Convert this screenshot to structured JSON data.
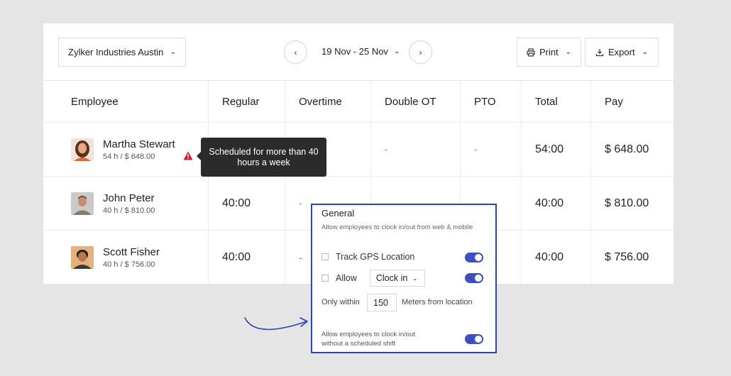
{
  "toolbar": {
    "org": "Zylker Industries Austin",
    "date_range": "19 Nov - 25 Nov",
    "print_label": "Print",
    "export_label": "Export"
  },
  "table": {
    "headers": [
      "Employee",
      "Regular",
      "Overtime",
      "Double OT",
      "PTO",
      "Total",
      "Pay"
    ],
    "rows": [
      {
        "name": "Martha Stewart",
        "sub": "54 h / $ 648.00",
        "regular": "",
        "overtime": "",
        "double_ot": "-",
        "pto": "-",
        "total": "54:00",
        "pay": "$ 648.00"
      },
      {
        "name": "John Peter",
        "sub": "40 h / $ 810.00",
        "regular": "40:00",
        "overtime": "-",
        "double_ot": "",
        "pto": "",
        "total": "40:00",
        "pay": "$ 810.00"
      },
      {
        "name": "Scott Fisher",
        "sub": "40 h / $ 756.00",
        "regular": "40:00",
        "overtime": "-",
        "double_ot": "",
        "pto": "",
        "total": "40:00",
        "pay": "$ 756.00"
      }
    ]
  },
  "tooltip": {
    "text": "Scheduled for more than 40 hours a week"
  },
  "panel": {
    "title": "General",
    "description": "Allow employees to clock in/out from web & mobile",
    "gps_label": "Track GPS Location",
    "allow_label": "Allow",
    "allow_select": "Clock in",
    "within_label": "Only within",
    "meters_value": "150",
    "meters_label": "Meters from location",
    "shift_desc": "Allow employees to clock in/out without a scheduled shift"
  },
  "colors": {
    "accent": "#3b4fc1",
    "panel_border": "#2d42b4",
    "warning": "#d0202a",
    "tooltip_bg": "#2b2b2b"
  }
}
